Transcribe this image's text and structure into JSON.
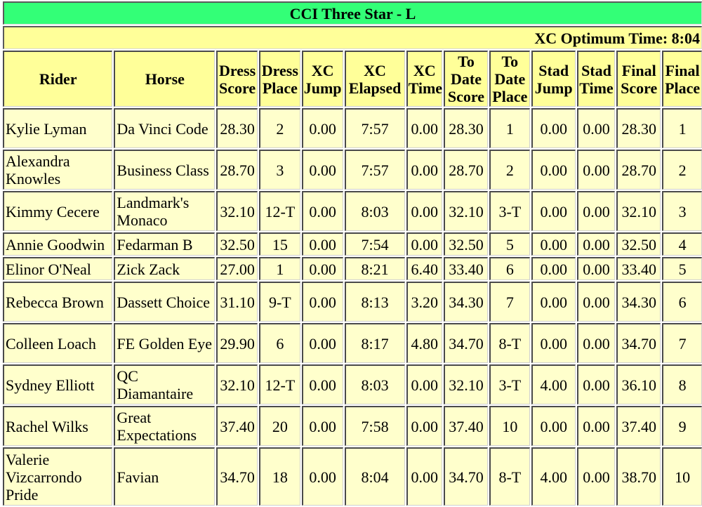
{
  "title": "CCI Three Star - L",
  "xc_optimum_time_label": "XC Optimum Time: 8:04",
  "colors": {
    "title_bg": "#33ff77",
    "header_bg": "#ffff99",
    "cell_bg": "#ffffcc"
  },
  "columns": [
    {
      "key": "rider",
      "label": "Rider"
    },
    {
      "key": "horse",
      "label": "Horse"
    },
    {
      "key": "dress_score",
      "label": "Dress Score"
    },
    {
      "key": "dress_place",
      "label": "Dress Place"
    },
    {
      "key": "xc_jump",
      "label": "XC Jump"
    },
    {
      "key": "xc_elapsed",
      "label": "XC Elapsed"
    },
    {
      "key": "xc_time",
      "label": "XC Time"
    },
    {
      "key": "to_date_score",
      "label": "To Date Score"
    },
    {
      "key": "to_date_place",
      "label": "To Date Place"
    },
    {
      "key": "stad_jump",
      "label": "Stad Jump"
    },
    {
      "key": "stad_time",
      "label": "Stad Time"
    },
    {
      "key": "final_score",
      "label": "Final Score"
    },
    {
      "key": "final_place",
      "label": "Final Place"
    }
  ],
  "rows": [
    {
      "rider": "Kylie Lyman",
      "horse": "Da Vinci Code",
      "dress_score": "28.30",
      "dress_place": "2",
      "xc_jump": "0.00",
      "xc_elapsed": "7:57",
      "xc_time": "0.00",
      "to_date_score": "28.30",
      "to_date_place": "1",
      "stad_jump": "0.00",
      "stad_time": "0.00",
      "final_score": "28.30",
      "final_place": "1"
    },
    {
      "rider": "Alexandra Knowles",
      "horse": "Business Class",
      "dress_score": "28.70",
      "dress_place": "3",
      "xc_jump": "0.00",
      "xc_elapsed": "7:57",
      "xc_time": "0.00",
      "to_date_score": "28.70",
      "to_date_place": "2",
      "stad_jump": "0.00",
      "stad_time": "0.00",
      "final_score": "28.70",
      "final_place": "2"
    },
    {
      "rider": "Kimmy Cecere",
      "horse": "Landmark's Monaco",
      "dress_score": "32.10",
      "dress_place": "12-T",
      "xc_jump": "0.00",
      "xc_elapsed": "8:03",
      "xc_time": "0.00",
      "to_date_score": "32.10",
      "to_date_place": "3-T",
      "stad_jump": "0.00",
      "stad_time": "0.00",
      "final_score": "32.10",
      "final_place": "3"
    },
    {
      "rider": "Annie Goodwin",
      "horse": "Fedarman B",
      "dress_score": "32.50",
      "dress_place": "15",
      "xc_jump": "0.00",
      "xc_elapsed": "7:54",
      "xc_time": "0.00",
      "to_date_score": "32.50",
      "to_date_place": "5",
      "stad_jump": "0.00",
      "stad_time": "0.00",
      "final_score": "32.50",
      "final_place": "4"
    },
    {
      "rider": "Elinor O'Neal",
      "horse": "Zick Zack",
      "dress_score": "27.00",
      "dress_place": "1",
      "xc_jump": "0.00",
      "xc_elapsed": "8:21",
      "xc_time": "6.40",
      "to_date_score": "33.40",
      "to_date_place": "6",
      "stad_jump": "0.00",
      "stad_time": "0.00",
      "final_score": "33.40",
      "final_place": "5"
    },
    {
      "rider": "Rebecca Brown",
      "horse": "Dassett Choice",
      "dress_score": "31.10",
      "dress_place": "9-T",
      "xc_jump": "0.00",
      "xc_elapsed": "8:13",
      "xc_time": "3.20",
      "to_date_score": "34.30",
      "to_date_place": "7",
      "stad_jump": "0.00",
      "stad_time": "0.00",
      "final_score": "34.30",
      "final_place": "6"
    },
    {
      "rider": "Colleen Loach",
      "horse": "FE Golden Eye",
      "dress_score": "29.90",
      "dress_place": "6",
      "xc_jump": "0.00",
      "xc_elapsed": "8:17",
      "xc_time": "4.80",
      "to_date_score": "34.70",
      "to_date_place": "8-T",
      "stad_jump": "0.00",
      "stad_time": "0.00",
      "final_score": "34.70",
      "final_place": "7"
    },
    {
      "rider": "Sydney Elliott",
      "horse": "QC Diamantaire",
      "dress_score": "32.10",
      "dress_place": "12-T",
      "xc_jump": "0.00",
      "xc_elapsed": "8:03",
      "xc_time": "0.00",
      "to_date_score": "32.10",
      "to_date_place": "3-T",
      "stad_jump": "4.00",
      "stad_time": "0.00",
      "final_score": "36.10",
      "final_place": "8"
    },
    {
      "rider": "Rachel Wilks",
      "horse": "Great Expectations",
      "dress_score": "37.40",
      "dress_place": "20",
      "xc_jump": "0.00",
      "xc_elapsed": "7:58",
      "xc_time": "0.00",
      "to_date_score": "37.40",
      "to_date_place": "10",
      "stad_jump": "0.00",
      "stad_time": "0.00",
      "final_score": "37.40",
      "final_place": "9"
    },
    {
      "rider": "Valerie Vizcarrondo Pride",
      "horse": "Favian",
      "dress_score": "34.70",
      "dress_place": "18",
      "xc_jump": "0.00",
      "xc_elapsed": "8:04",
      "xc_time": "0.00",
      "to_date_score": "34.70",
      "to_date_place": "8-T",
      "stad_jump": "4.00",
      "stad_time": "0.00",
      "final_score": "38.70",
      "final_place": "10"
    }
  ]
}
